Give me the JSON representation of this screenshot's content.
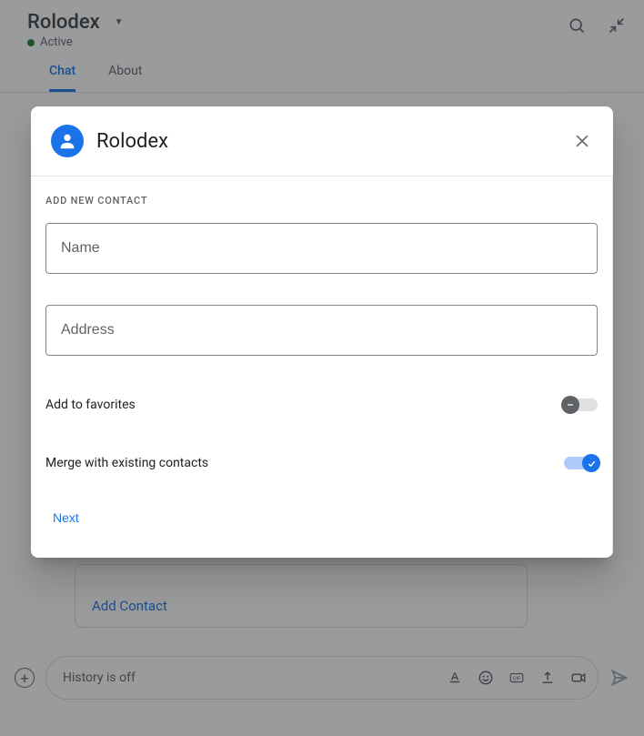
{
  "header": {
    "title": "Rolodex",
    "status": "Active"
  },
  "tabs": {
    "chat": "Chat",
    "about": "About"
  },
  "card": {
    "add_contact": "Add Contact"
  },
  "compose": {
    "placeholder": "History is off"
  },
  "dialog": {
    "title": "Rolodex",
    "section": "ADD NEW CONTACT",
    "name_placeholder": "Name",
    "address_placeholder": "Address",
    "favorites_label": "Add to favorites",
    "merge_label": "Merge with existing contacts",
    "next": "Next"
  }
}
